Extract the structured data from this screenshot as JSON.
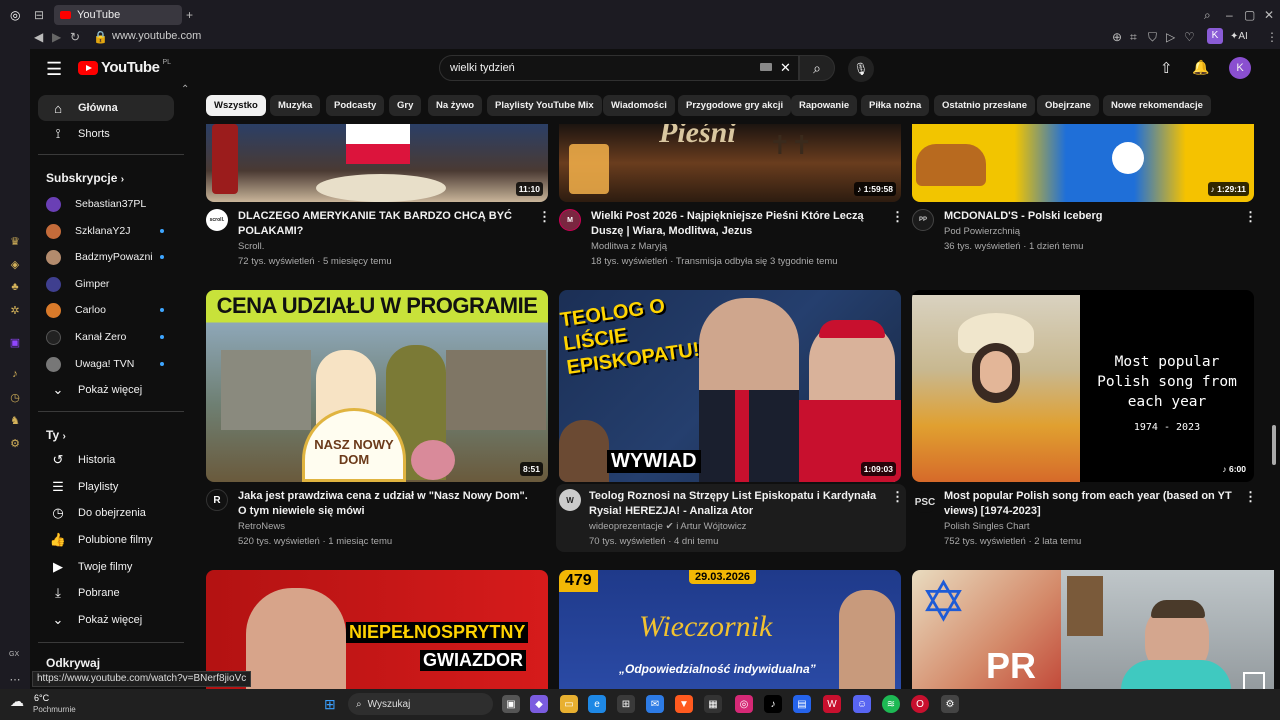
{
  "browser": {
    "tab_title": "YouTube",
    "url": "www.youtube.com",
    "ai_label": "AI",
    "profile_letter": "K",
    "status_url": "https://www.youtube.com/watch?v=BNerf8jioVc"
  },
  "header": {
    "logo_text": "YouTube",
    "region": "PL",
    "search_value": "wielki tydzień",
    "avatar_letter": "K"
  },
  "nav": {
    "main": [
      {
        "label": "Główna",
        "icon": "home-icon"
      },
      {
        "label": "Shorts",
        "icon": "shorts-icon"
      }
    ],
    "subscriptions_title": "Subskrypcje",
    "subscriptions": [
      {
        "label": "Sebastian37PL",
        "live": false,
        "color": "#6a3fb5"
      },
      {
        "label": "SzklanaY2J",
        "live": true,
        "color": "#c46b3a"
      },
      {
        "label": "BadzmyPowazni",
        "live": true,
        "color": "#b38b6d"
      },
      {
        "label": "Gimper",
        "live": false,
        "color": "#3f3f8f"
      },
      {
        "label": "Carloo",
        "live": true,
        "color": "#d97a2a"
      },
      {
        "label": "Kanał Zero",
        "live": true,
        "color": "#222222"
      },
      {
        "label": "Uwaga! TVN",
        "live": true,
        "color": "#777777"
      }
    ],
    "show_more": "Pokaż więcej",
    "you_title": "Ty",
    "you": [
      {
        "label": "Historia",
        "icon": "history-icon"
      },
      {
        "label": "Playlisty",
        "icon": "playlist-icon"
      },
      {
        "label": "Do obejrzenia",
        "icon": "clock-icon"
      },
      {
        "label": "Polubione filmy",
        "icon": "thumbs-up-icon"
      },
      {
        "label": "Twoje filmy",
        "icon": "video-icon"
      },
      {
        "label": "Pobrane",
        "icon": "download-icon"
      }
    ],
    "show_more_2": "Pokaż więcej",
    "explore_title": "Odkrywaj",
    "gx_label": "GX"
  },
  "chips": [
    "Wszystko",
    "Muzyka",
    "Podcasty",
    "Gry",
    "Na żywo",
    "Playlisty YouTube Mix",
    "Wiadomości",
    "Przygodowe gry akcji",
    "Rapowanie",
    "Piłka nożna",
    "Ostatnio przesłane",
    "Obejrzane",
    "Nowe rekomendacje"
  ],
  "videos": [
    {
      "title": "DLACZEGO AMERYKANIE TAK BARDZO CHCĄ BYĆ POLAKAMI?",
      "channel": "Scroll.",
      "avatar": "scroll.",
      "stats": "72 tys. wyświetleń · 5 miesięcy temu",
      "duration": "11:10"
    },
    {
      "title": "Wielki Post 2026 - Najpiękniejsze Pieśni Które Leczą Duszę | Wiara, Modlitwa, Jezus",
      "channel": "Modlitwa z Maryją",
      "avatar": "M",
      "stats": "18 tys. wyświetleń · Transmisja odbyła się 3 tygodnie temu",
      "duration": "1:59:58",
      "thumb_text": "Pieśni"
    },
    {
      "title": "MCDONALD'S - Polski Iceberg",
      "channel": "Pod Powierzchnią",
      "avatar": "PP",
      "stats": "36 tys. wyświetleń · 1 dzień temu",
      "duration": "1:29:11"
    },
    {
      "title": "Jaka jest prawdziwa cena z udział w \"Nasz Nowy Dom\". O tym niewiele się mówi",
      "channel": "RetroNews",
      "avatar": "R",
      "stats": "520 tys. wyświetleń · 1 miesiąc temu",
      "duration": "8:51",
      "thumb_text": "CENA UDZIAŁU W PROGRAMIE",
      "thumb_text2": "NASZ NOWY DOM"
    },
    {
      "title": "Teolog Roznosi na Strzępy List Episkopatu i Kardynała Rysia! HEREZJA! - Analiza Ator",
      "channel": "wideoprezentacje",
      "collab": "i Artur Wójtowicz",
      "avatar": "W",
      "stats": "70 tys. wyświetleń · 4 dni temu",
      "duration": "1:09:03",
      "thumb_text": "TEOLOG O LIŚCIE EPISKOPATU!",
      "thumb_text2": "WYWIAD"
    },
    {
      "title": "Most popular Polish song from each year (based on YT views) [1974-2023]",
      "channel": "Polish Singles Chart",
      "avatar": "PSC",
      "stats": "752 tys. wyświetleń · 2 lata temu",
      "duration": "6:00",
      "thumb_text": "Most popular Polish song from each year",
      "thumb_text2": "1974 - 2023"
    },
    {
      "thumb_text": "NIEPEŁNOSPRYTNY",
      "thumb_text2": "GWIAZDOR"
    },
    {
      "thumb_text": "Wieczornik",
      "thumb_text2": "„Odpowiedzialność indywidualna”",
      "badge": "479",
      "date": "29.03.2026"
    },
    {
      "thumb_text": "PR"
    }
  ],
  "taskbar": {
    "temp": "6°C",
    "weather": "Pochmurnie",
    "search": "Wyszukaj"
  },
  "colors": {
    "accent": "#ff0000",
    "bg": "#0f0f0f",
    "chip": "#272727",
    "live": "#3ea6ff"
  }
}
